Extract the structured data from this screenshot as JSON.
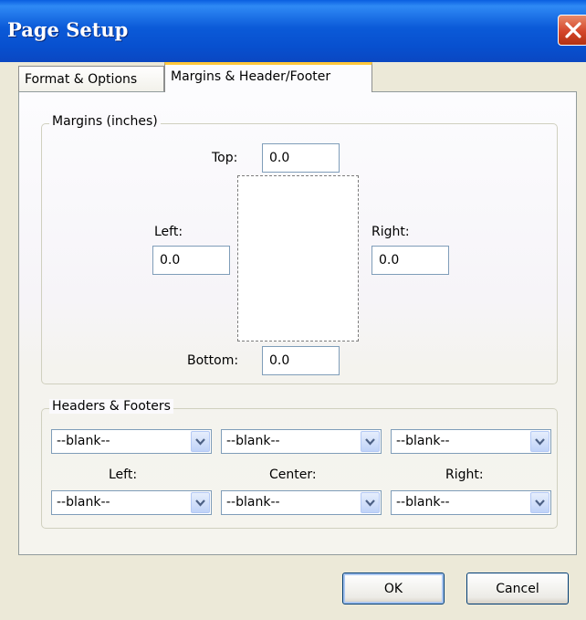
{
  "window": {
    "title": "Page Setup"
  },
  "tabs": [
    {
      "label": "Format & Options",
      "active": false
    },
    {
      "label": "Margins & Header/Footer",
      "active": true
    }
  ],
  "margins": {
    "group_label": "Margins (inches)",
    "top": {
      "label": "Top:",
      "value": "0.0"
    },
    "left": {
      "label": "Left:",
      "value": "0.0"
    },
    "right": {
      "label": "Right:",
      "value": "0.0"
    },
    "bottom": {
      "label": "Bottom:",
      "value": "0.0"
    }
  },
  "headers_footers": {
    "group_label": "Headers & Footers",
    "column_labels": [
      "Left:",
      "Center:",
      "Right:"
    ],
    "header_values": [
      "--blank--",
      "--blank--",
      "--blank--"
    ],
    "footer_values": [
      "--blank--",
      "--blank--",
      "--blank--"
    ]
  },
  "buttons": {
    "ok": "OK",
    "cancel": "Cancel"
  },
  "colors": {
    "titlebar": "#0a5ad8",
    "close": "#d4462a",
    "active_tab_accent": "#ffc83c"
  },
  "icons": {
    "close": "close-icon",
    "dropdown": "chevron-down-icon"
  }
}
